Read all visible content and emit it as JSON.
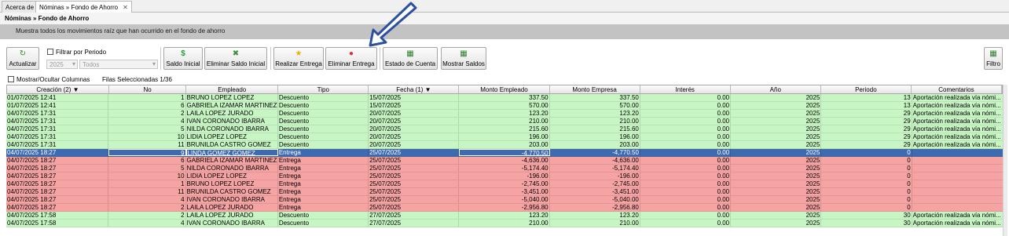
{
  "tabs": [
    {
      "label": "Acerca de"
    },
    {
      "label": "Nóminas » Fondo de Ahorro",
      "close": "✕"
    }
  ],
  "header": {
    "title": "Nóminas » Fondo de Ahorro",
    "subtitle": "Muestra todos los movimientos raíz que han ocurrido en el fondo de ahorro"
  },
  "toolbar": {
    "actualizar": "Actualizar",
    "filtrar_periodo": "Filtrar por Periodo",
    "year_value": "2025",
    "period_value": "Todos",
    "saldo_inicial": "Saldo Inicial",
    "eliminar_saldo_inicial": "Eliminar Saldo Inicial",
    "realizar_entrega": "Realizar Entrega",
    "eliminar_entrega": "Eliminar Entrega",
    "estado_cuenta": "Estado de Cuenta",
    "mostrar_saldos": "Mostrar Saldos",
    "filtro": "Filtro"
  },
  "info": {
    "mostrar_columnas": "Mostrar/Ocultar Columnas",
    "filas_seleccionadas": "Filas Seleccionadas 1/36"
  },
  "colors": {
    "green_row": "#c8f5c4",
    "red_row": "#f5a3a3",
    "selected_row": "#3e6ab0",
    "annotation_arrow": "#2d4fa0"
  },
  "grid": {
    "columns": [
      "Creación (2)",
      "No",
      "Empleado",
      "Tipo",
      "Fecha (1)",
      "Monto Empleado",
      "Monto Empresa",
      "Interés",
      "Año",
      "Periodo",
      "Comentarios"
    ],
    "rows": [
      {
        "status": "green",
        "cells": [
          "01/07/2025 12:41",
          "1",
          "BRUNO LOPEZ LOPEZ",
          "Descuento",
          "15/07/2025",
          "337.50",
          "337.50",
          "0.00",
          "2025",
          "13",
          "Aportación realizada vía nómi..."
        ]
      },
      {
        "status": "green",
        "cells": [
          "01/07/2025 12:41",
          "6",
          "GABRIELA IZAMAR MARTINEZ",
          "Descuento",
          "15/07/2025",
          "570.00",
          "570.00",
          "0.00",
          "2025",
          "13",
          "Aportación realizada vía nómi..."
        ]
      },
      {
        "status": "green",
        "cells": [
          "04/07/2025 17:31",
          "2",
          "LAILA LOPEZ JURADO",
          "Descuento",
          "20/07/2025",
          "123.20",
          "123.20",
          "0.00",
          "2025",
          "29",
          "Aportación realizada vía nómi..."
        ]
      },
      {
        "status": "green",
        "cells": [
          "04/07/2025 17:31",
          "4",
          "IVAN CORONADO IBARRA",
          "Descuento",
          "20/07/2025",
          "210.00",
          "210.00",
          "0.00",
          "2025",
          "29",
          "Aportación realizada vía nómi..."
        ]
      },
      {
        "status": "green",
        "cells": [
          "04/07/2025 17:31",
          "5",
          "NILDA CORONADO IBARRA",
          "Descuento",
          "20/07/2025",
          "215.60",
          "215.60",
          "0.00",
          "2025",
          "29",
          "Aportación realizada vía nómi..."
        ]
      },
      {
        "status": "green",
        "cells": [
          "04/07/2025 17:31",
          "10",
          "LIDIA LOPEZ LOPEZ",
          "Descuento",
          "20/07/2025",
          "196.00",
          "196.00",
          "0.00",
          "2025",
          "29",
          "Aportación realizada vía nómi..."
        ]
      },
      {
        "status": "green",
        "cells": [
          "04/07/2025 17:31",
          "11",
          "BRUNILDA CASTRO GOMEZ",
          "Descuento",
          "20/07/2025",
          "203.00",
          "203.00",
          "0.00",
          "2025",
          "29",
          "Aportación realizada vía nómi..."
        ]
      },
      {
        "status": "selected",
        "cells": [
          "04/07/2025 18:27",
          "9",
          "LINDA GOMEZ GOMEZ",
          "Entrega",
          "25/07/2025",
          "-4,770.50",
          "-4,770.50",
          "0.00",
          "2025",
          "0",
          ""
        ]
      },
      {
        "status": "red",
        "cells": [
          "04/07/2025 18:27",
          "6",
          "GABRIELA IZAMAR MARTINEZ",
          "Entrega",
          "25/07/2025",
          "-4,636.00",
          "-4,636.00",
          "0.00",
          "2025",
          "0",
          ""
        ]
      },
      {
        "status": "red",
        "cells": [
          "04/07/2025 18:27",
          "5",
          "NILDA CORONADO IBARRA",
          "Entrega",
          "25/07/2025",
          "-5,174.40",
          "-5,174.40",
          "0.00",
          "2025",
          "0",
          ""
        ]
      },
      {
        "status": "red",
        "cells": [
          "04/07/2025 18:27",
          "10",
          "LIDIA LOPEZ LOPEZ",
          "Entrega",
          "25/07/2025",
          "-196.00",
          "-196.00",
          "0.00",
          "2025",
          "0",
          ""
        ]
      },
      {
        "status": "red",
        "cells": [
          "04/07/2025 18:27",
          "1",
          "BRUNO LOPEZ LOPEZ",
          "Entrega",
          "25/07/2025",
          "-2,745.00",
          "-2,745.00",
          "0.00",
          "2025",
          "0",
          ""
        ]
      },
      {
        "status": "red",
        "cells": [
          "04/07/2025 18:27",
          "11",
          "BRUNILDA CASTRO GOMEZ",
          "Entrega",
          "25/07/2025",
          "-3,451.00",
          "-3,451.00",
          "0.00",
          "2025",
          "0",
          ""
        ]
      },
      {
        "status": "red",
        "cells": [
          "04/07/2025 18:27",
          "4",
          "IVAN CORONADO IBARRA",
          "Entrega",
          "25/07/2025",
          "-5,040.00",
          "-5,040.00",
          "0.00",
          "2025",
          "0",
          ""
        ]
      },
      {
        "status": "red",
        "cells": [
          "04/07/2025 18:27",
          "2",
          "LAILA LOPEZ JURADO",
          "Entrega",
          "25/07/2025",
          "-2,956.80",
          "-2,956.80",
          "0.00",
          "2025",
          "0",
          ""
        ]
      },
      {
        "status": "green",
        "cells": [
          "04/07/2025 17:58",
          "2",
          "LAILA LOPEZ JURADO",
          "Descuento",
          "27/07/2025",
          "123.20",
          "123.20",
          "0.00",
          "2025",
          "30",
          "Aportación realizada vía nómi..."
        ]
      },
      {
        "status": "green",
        "cells": [
          "04/07/2025 17:58",
          "4",
          "IVAN CORONADO IBARRA",
          "Descuento",
          "27/07/2025",
          "210.00",
          "210.00",
          "0.00",
          "2025",
          "30",
          "Aportación realizada vía nómi..."
        ]
      }
    ]
  }
}
